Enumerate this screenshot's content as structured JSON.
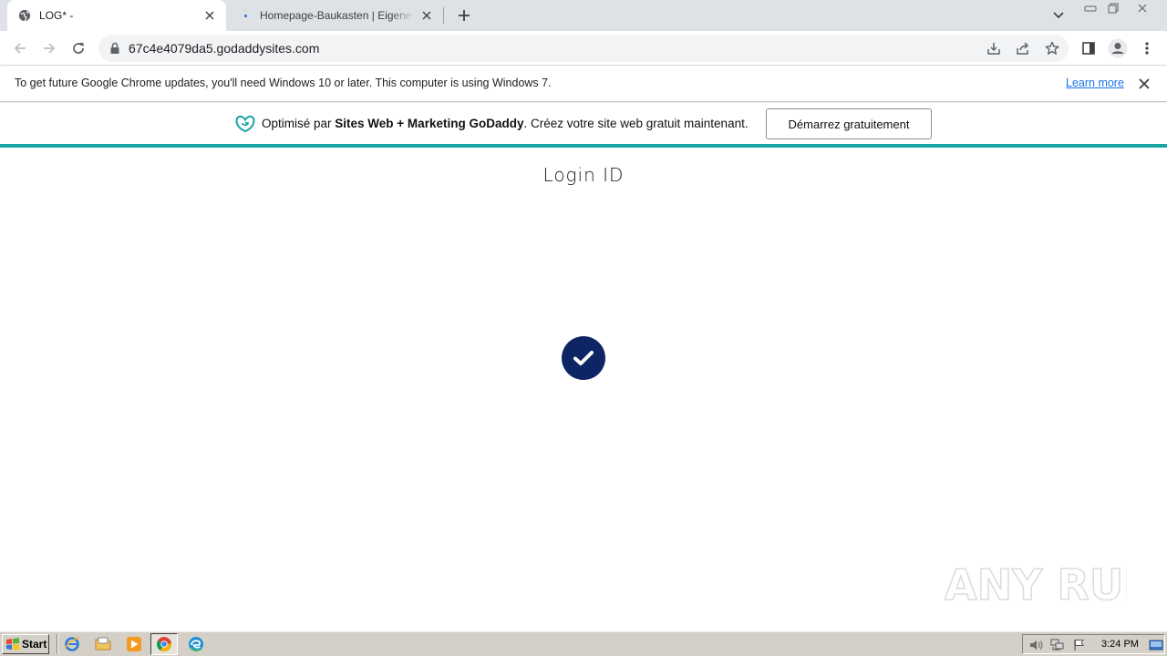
{
  "browser": {
    "tabs": [
      {
        "title": "LOG* -",
        "favicon": "globe-icon",
        "active": true
      },
      {
        "title": "Homepage-Baukasten | Eigene Website",
        "favicon": "loading-dot-icon",
        "active": false
      }
    ],
    "url": "67c4e4079da5.godaddysites.com"
  },
  "infobar": {
    "message": "To get future Google Chrome updates, you'll need Windows 10 or later. This computer is using Windows 7.",
    "link_label": "Learn more"
  },
  "banner": {
    "prefix": "Optimisé par ",
    "brand": "Sites Web + Marketing GoDaddy",
    "suffix": ". Créez votre site web gratuit maintenant.",
    "cta_label": "Démarrez gratuitement",
    "accent_color": "#1ba4a4"
  },
  "page": {
    "title": "Login ID",
    "status_icon": "checkmark-icon",
    "status_color": "#0e2565"
  },
  "watermark": {
    "text": "ANY RUN"
  },
  "taskbar": {
    "start_label": "Start",
    "clock": "3:24 PM",
    "quick_launch": [
      "internet-explorer-icon",
      "folder-icon",
      "media-player-icon",
      "chrome-icon",
      "edge-icon"
    ]
  }
}
